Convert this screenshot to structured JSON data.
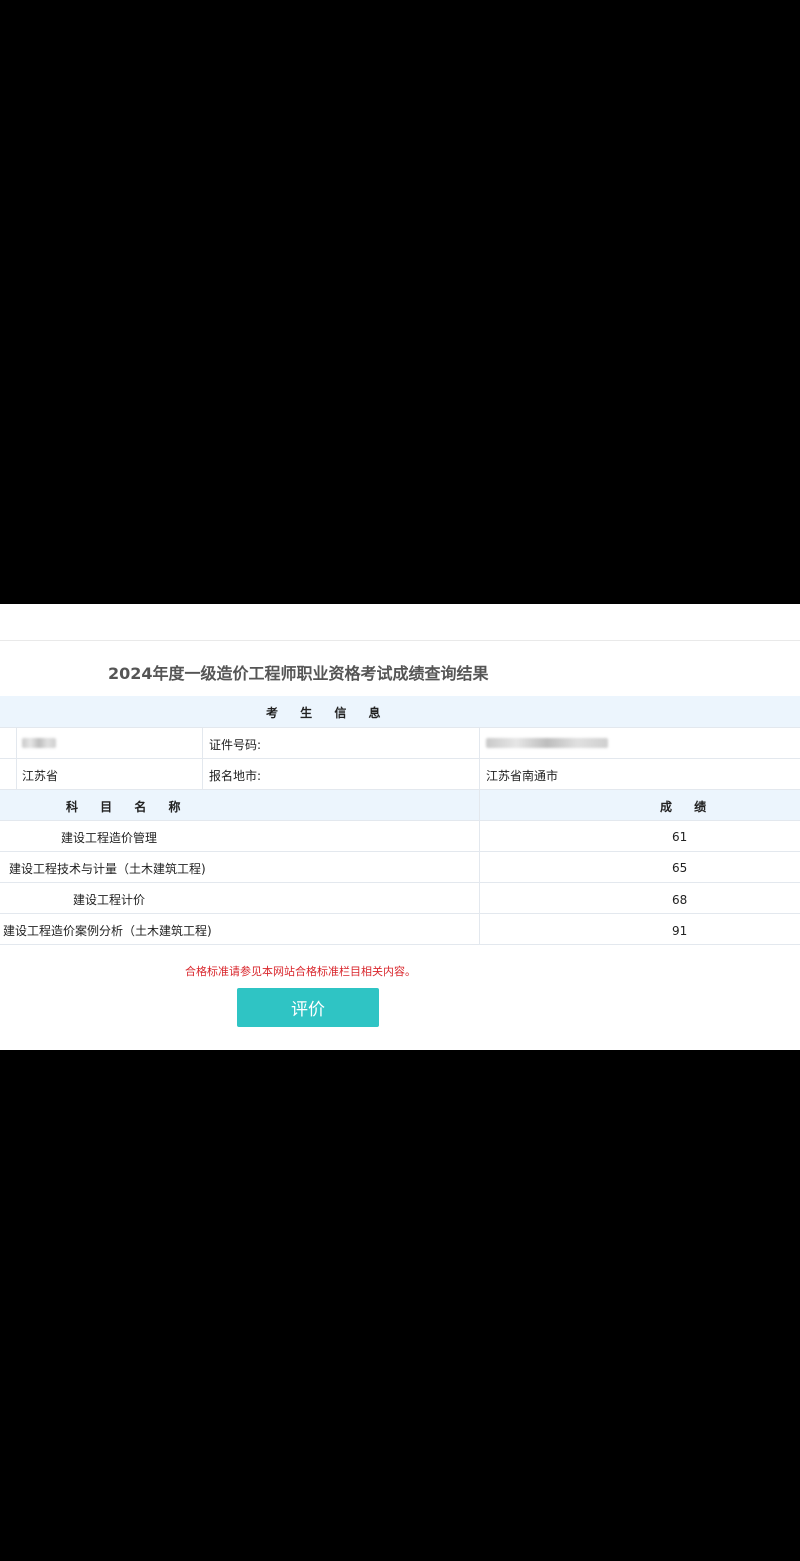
{
  "page": {
    "title": "2024年度一级造价工程师职业资格考试成绩查询结果"
  },
  "candidate": {
    "section_label": "考 生 信 息",
    "id_label": "证件号码:",
    "province": "江苏省",
    "city_label": "报名地市:",
    "city_value": "江苏省南通市"
  },
  "scores": {
    "subject_header": "科 目 名 称",
    "score_header": "成 绩",
    "rows": [
      {
        "subject": "建设工程造价管理",
        "score": "61"
      },
      {
        "subject": "建设工程技术与计量（土木建筑工程)",
        "score": "65"
      },
      {
        "subject": "建设工程计价",
        "score": "68"
      },
      {
        "subject": "建设工程造价案例分析（土木建筑工程)",
        "score": "91"
      }
    ]
  },
  "note": "合格标准请参见本网站合格标准栏目相关内容。",
  "actions": {
    "evaluate_label": "评价"
  },
  "colors": {
    "button": "#2fc4c4",
    "note": "#d9262c",
    "header_band": "#ecf5fd"
  }
}
